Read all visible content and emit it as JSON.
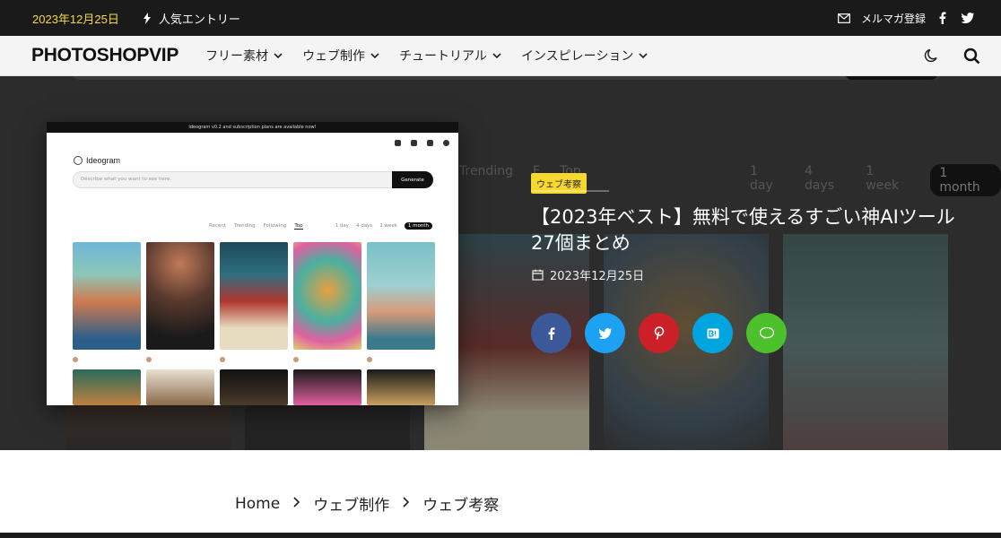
{
  "topbar": {
    "date": "2023年12月25日",
    "popular": "人気エントリー",
    "newsletter": "メルマガ登録"
  },
  "nav": {
    "logo": "PHOTOSHOPVIP",
    "menu": [
      "フリー素材",
      "ウェブ制作",
      "チュートリアル",
      "インスピレーション"
    ]
  },
  "hero": {
    "category": "ウェブ考察",
    "title": "【2023年ベスト】無料で使えるすごい神AIツール27個まとめ",
    "date": "2023年12月25日",
    "share": [
      "facebook",
      "twitter",
      "pinterest",
      "hatena",
      "line"
    ],
    "colors": {
      "facebook": "#3b5998",
      "twitter": "#1da1f2",
      "pinterest": "#cb2027",
      "hatena": "#00a4de",
      "line": "#4cc12c",
      "badge": "#f5d730"
    },
    "background_tabs": [
      "Trending",
      "F",
      "Top"
    ],
    "background_times": [
      "1 day",
      "4 days",
      "1 week",
      "1 month"
    ],
    "screenshot": {
      "banner": "Ideogram v0.2 and subscription plans are available now!",
      "logo": "Ideogram",
      "search_placeholder": "Describe what you want to see here.",
      "generate": "Generate",
      "tabs": [
        "Recent",
        "Trending",
        "Following",
        "Top"
      ],
      "times": [
        "1 day",
        "4 days",
        "1 week",
        "1 month"
      ]
    }
  },
  "breadcrumb": [
    "Home",
    "ウェブ制作",
    "ウェブ考察"
  ]
}
